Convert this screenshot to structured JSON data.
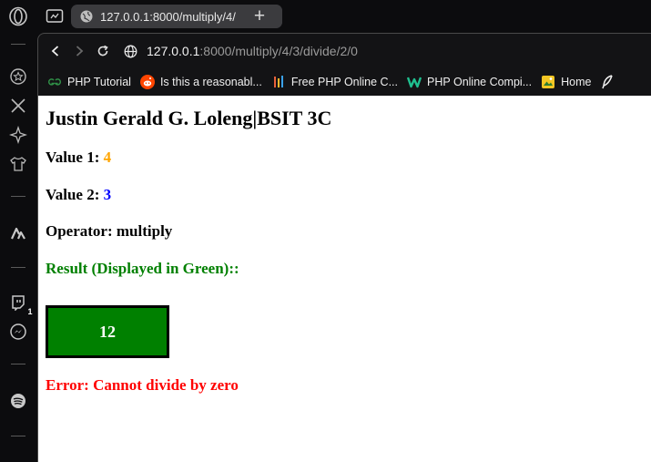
{
  "browser": {
    "tab": {
      "title": "127.0.0.1:8000/multiply/4/"
    },
    "url": {
      "host": "127.0.0.1",
      "rest": ":8000/multiply/4/3/divide/2/0"
    },
    "new_tab_symbol": "+",
    "sidebar_badge": "1",
    "sidebar_icons": [
      "opera-logo-icon",
      "star-icon",
      "x-icon",
      "ai-aria-icon",
      "shirt-icon",
      "arc-app-icon",
      "twitch-icon",
      "messenger-icon",
      "spotify-icon"
    ],
    "bookmarks": [
      {
        "label": "PHP Tutorial",
        "icon": "geeksforgeeks-icon"
      },
      {
        "label": "Is this a reasonabl...",
        "icon": "reddit-icon"
      },
      {
        "label": "Free PHP Online C...",
        "icon": "compiler-icon"
      },
      {
        "label": "PHP Online Compi...",
        "icon": "w-icon"
      },
      {
        "label": "Home",
        "icon": "home-icon"
      }
    ]
  },
  "page": {
    "heading": "Justin Gerald G. Loleng|BSIT 3C",
    "value1": {
      "label": "Value 1:",
      "value": "4",
      "color": "#ffa500"
    },
    "value2": {
      "label": "Value 2:",
      "value": "3",
      "color": "#0000ff"
    },
    "operator": {
      "label": "Operator:",
      "value": "multiply"
    },
    "result_label": "Result (Displayed in Green)::",
    "result_value": "12",
    "error": "Error: Cannot divide by zero"
  }
}
